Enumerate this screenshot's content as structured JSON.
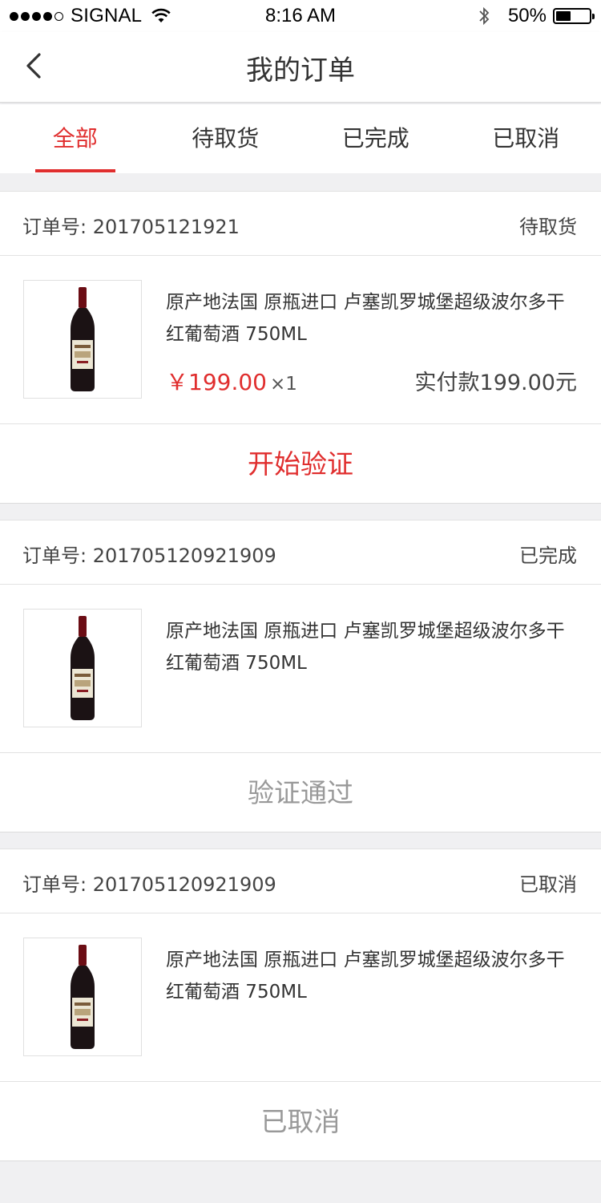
{
  "status_bar": {
    "carrier": "SIGNAL",
    "time": "8:16 AM",
    "battery_text": "50%",
    "battery_level": 0.5
  },
  "nav": {
    "title": "我的订单",
    "back_icon": "chevron-left-icon"
  },
  "tabs": [
    {
      "label": "全部",
      "active": true
    },
    {
      "label": "待取货",
      "active": false
    },
    {
      "label": "已完成",
      "active": false
    },
    {
      "label": "已取消",
      "active": false
    }
  ],
  "colors": {
    "accent": "#e02e2e",
    "muted": "#999999",
    "background": "#f0f0f2"
  },
  "orders": [
    {
      "order_no": "订单号: 201705121921",
      "status": "待取货",
      "product_name": "原产地法国  原瓶进口  卢塞凯罗城堡超级波尔多干红葡萄酒   750ML",
      "price": "￥199.00",
      "qty": "×1",
      "paid": "实付款199.00元",
      "action": "开始验证",
      "action_style": "red"
    },
    {
      "order_no": "订单号: 201705120921909",
      "status": "已完成",
      "product_name": "原产地法国  原瓶进口  卢塞凯罗城堡超级波尔多干红葡萄酒   750ML",
      "action": "验证通过",
      "action_style": "gray"
    },
    {
      "order_no": "订单号: 201705120921909",
      "status": "已取消",
      "product_name": "原产地法国  原瓶进口  卢塞凯罗城堡超级波尔多干红葡萄酒   750ML",
      "action": "已取消",
      "action_style": "gray"
    }
  ]
}
